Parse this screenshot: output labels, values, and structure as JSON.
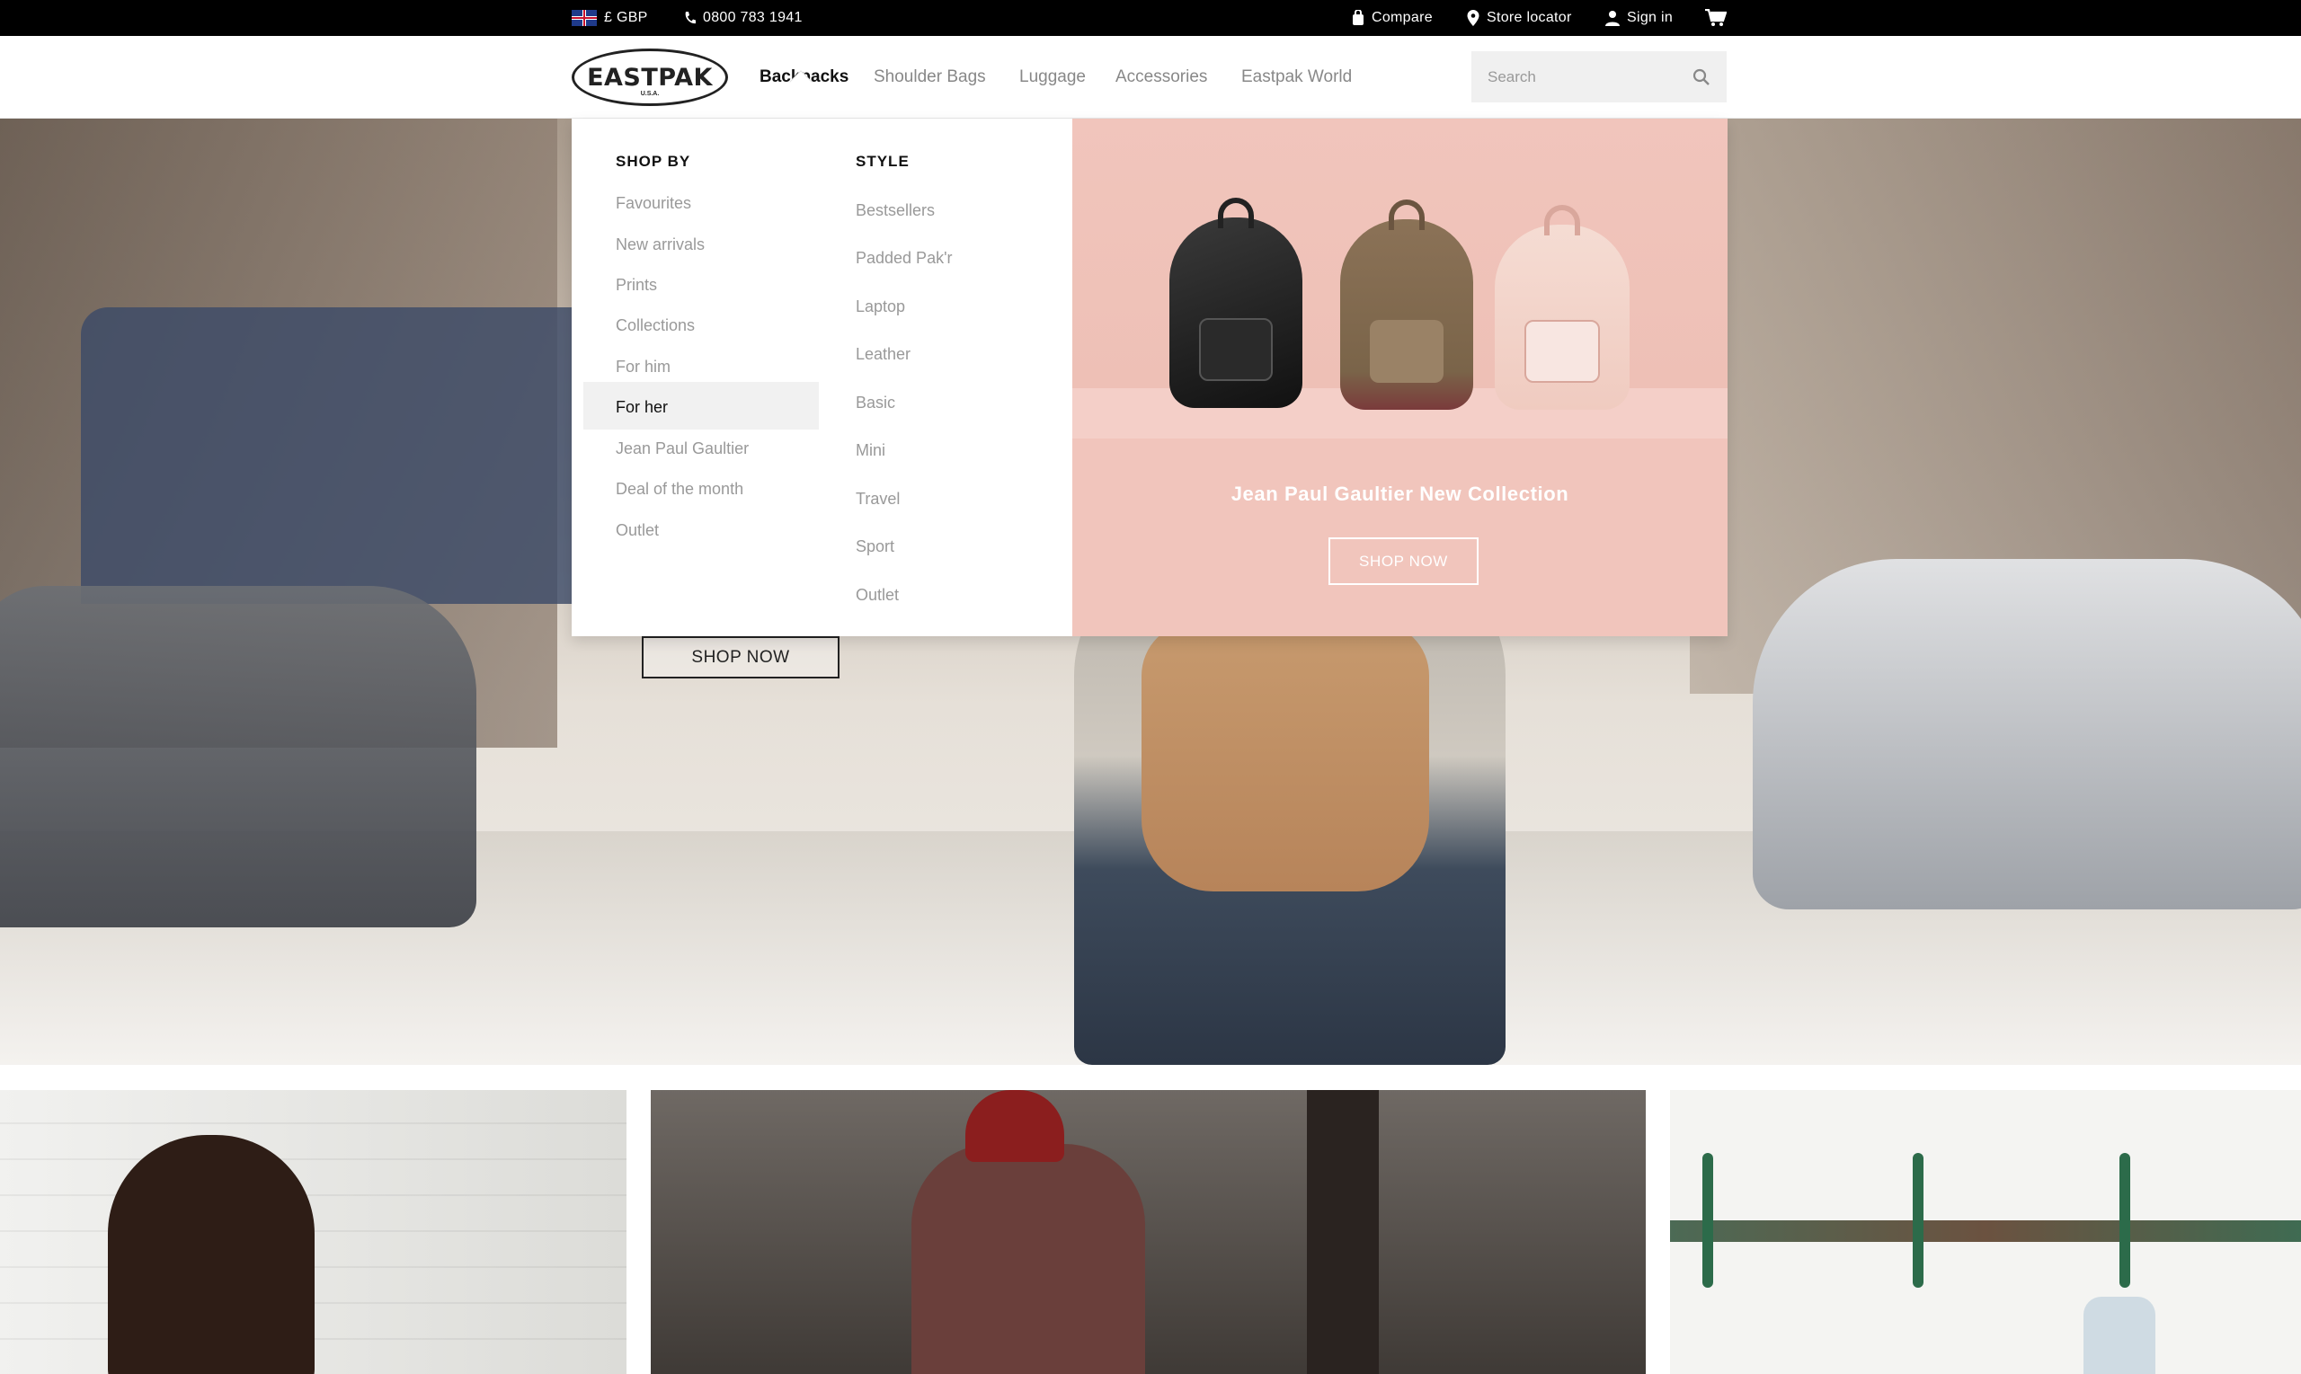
{
  "topbar": {
    "currency": "£ GBP",
    "phone": "0800 783 1941",
    "compare": "Compare",
    "store_locator": "Store locator",
    "sign_in": "Sign in"
  },
  "header": {
    "logo_text": "EASTPAK",
    "logo_sub": "U.S.A.",
    "nav": [
      "Backpacks",
      "Shoulder Bags",
      "Luggage",
      "Accessories",
      "Eastpak World"
    ],
    "active_nav": "Backpacks",
    "search_placeholder": "Search"
  },
  "mega_menu": {
    "shop_by": {
      "title": "SHOP BY",
      "items": [
        "Favourites",
        "New arrivals",
        "Prints",
        "Collections",
        "For him",
        "For her",
        "Jean Paul Gaultier",
        "Deal of the month",
        "Outlet"
      ],
      "highlighted": "For her"
    },
    "style": {
      "title": "STYLE",
      "items": [
        "Bestsellers",
        "Padded Pak'r",
        "Laptop",
        "Leather",
        "Basic",
        "Mini",
        "Travel",
        "Sport",
        "Outlet"
      ]
    },
    "promo": {
      "title": "Jean Paul Gaultier New Collection",
      "button": "SHOP NOW"
    }
  },
  "hero": {
    "button": "SHOP NOW"
  },
  "colors": {
    "topbar_bg": "#000000",
    "promo_bg": "#f1c5bc",
    "highlight_bg": "#f1f1f1"
  }
}
